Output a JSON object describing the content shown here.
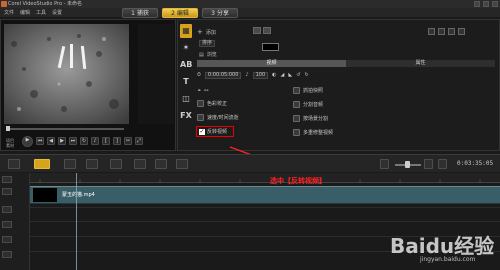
{
  "window": {
    "title": "Corel VideoStudio Pro - 未命名"
  },
  "menu": [
    "文件",
    "编辑",
    "工具",
    "设置"
  ],
  "steps": [
    {
      "num": "1",
      "label": "捕获"
    },
    {
      "num": "2",
      "label": "编辑"
    },
    {
      "num": "3",
      "label": "分享"
    }
  ],
  "preview": {
    "project_label": "项目",
    "clip_label": "素材",
    "timecode": "00:00:00:00"
  },
  "options": {
    "side_icons": [
      "media-icon",
      "instant-project-icon",
      "transition-icon",
      "title-icon",
      "graphic-icon",
      "filter-icon"
    ],
    "side_icon_glyphs": [
      "▦",
      "✶",
      "AB",
      "T",
      "◫",
      "FX"
    ],
    "add_label": "添加",
    "sort_value": "排序",
    "browse_label": "浏览",
    "tabs": [
      "视频",
      "属性"
    ],
    "duration": "0:00:05:000",
    "volume": "100",
    "properties_left": [
      "色彩校正",
      "速度/时间流逝",
      "反转视频"
    ],
    "properties_right": [
      "抓拍快照",
      "分割音频",
      "按场景分割",
      "多重修整视频"
    ]
  },
  "timeline": {
    "timecode": "0:03:35:05",
    "clip_name": "蒙玉的猫.mp4"
  },
  "annotation": "选中【反转视频】",
  "watermark": {
    "logo": "Baidu经验",
    "sub": "jingyan.baidu.com"
  },
  "colors": {
    "accent": "#d6a31f",
    "annotation": "#ff2222",
    "track": "#3a5e68"
  }
}
